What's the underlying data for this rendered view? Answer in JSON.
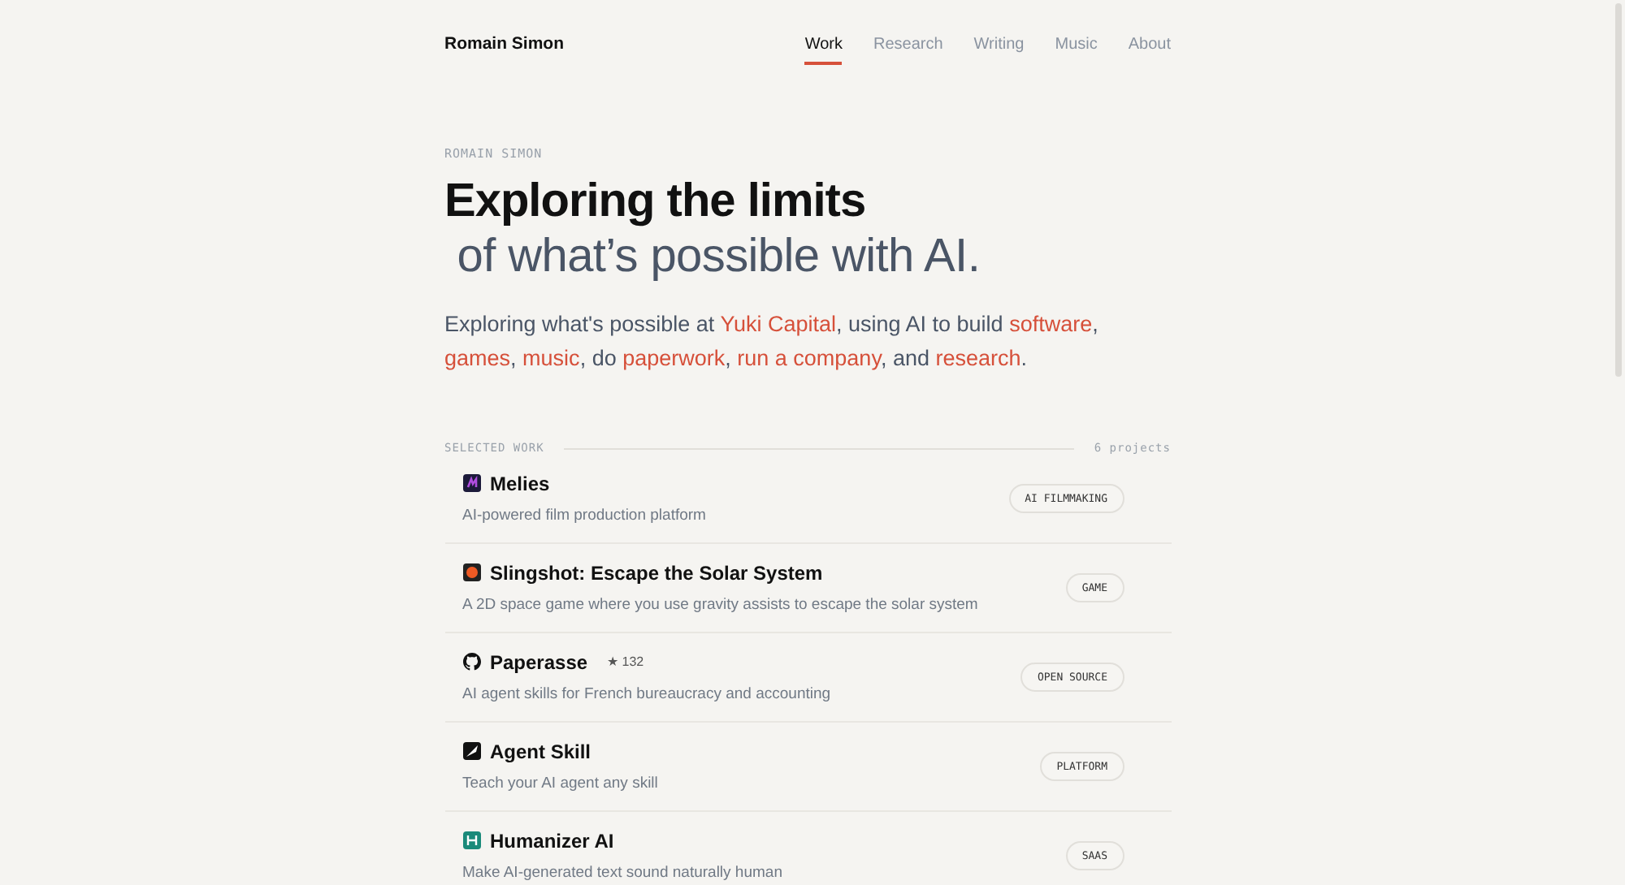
{
  "header": {
    "site_name": "Romain Simon",
    "nav": [
      {
        "label": "Work",
        "selected": true
      },
      {
        "label": "Research",
        "selected": false
      },
      {
        "label": "Writing",
        "selected": false
      },
      {
        "label": "Music",
        "selected": false
      },
      {
        "label": "About",
        "selected": false
      }
    ]
  },
  "hero": {
    "eyebrow": "ROMAIN SIMON",
    "title": "Exploring the limits",
    "subtitle": " of what’s possible with AI.",
    "intro": [
      {
        "text": "Exploring what's possible at ",
        "link": false
      },
      {
        "text": "Yuki Capital",
        "link": true
      },
      {
        "text": ", using AI to build ",
        "link": false
      },
      {
        "text": "software",
        "link": true
      },
      {
        "text": ", ",
        "link": false
      },
      {
        "text": "games",
        "link": true
      },
      {
        "text": ", ",
        "link": false
      },
      {
        "text": "music",
        "link": true
      },
      {
        "text": ", do ",
        "link": false
      },
      {
        "text": "paperwork",
        "link": true
      },
      {
        "text": ", ",
        "link": false
      },
      {
        "text": "run a company",
        "link": true
      },
      {
        "text": ", and ",
        "link": false
      },
      {
        "text": "research",
        "link": true
      },
      {
        "text": ".",
        "link": false
      }
    ]
  },
  "work": {
    "heading": "SELECTED WORK",
    "count": "6 projects",
    "projects": [
      {
        "kind": "melies",
        "title": "Melies",
        "description": "AI-powered film production platform",
        "tag": "AI FILMMAKING"
      },
      {
        "kind": "planet",
        "title": "Slingshot: Escape the Solar System",
        "description": "A 2D space game where you use gravity assists to escape the solar system",
        "tag": "GAME"
      },
      {
        "kind": "github",
        "title": "Paperasse",
        "stars_label": "★ 132",
        "description": "AI agent skills for French bureaucracy and accounting",
        "tag": "OPEN SOURCE"
      },
      {
        "kind": "feather",
        "title": "Agent Skill",
        "description": "Teach your AI agent any skill",
        "tag": "PLATFORM"
      },
      {
        "kind": "humanizer",
        "title": "Humanizer AI",
        "description": "Make AI-generated text sound naturally human",
        "tag": "SAAS"
      }
    ]
  }
}
